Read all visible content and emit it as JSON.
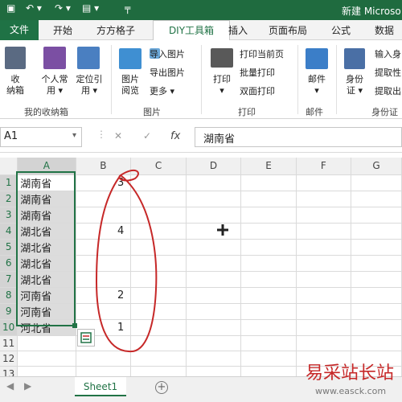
{
  "window": {
    "title": "新建 Microso"
  },
  "tabs": [
    {
      "label": "文件"
    },
    {
      "label": "开始"
    },
    {
      "label": "方方格子"
    },
    {
      "label": "DIY工具箱"
    },
    {
      "label": "插入"
    },
    {
      "label": "页面布局"
    },
    {
      "label": "公式"
    },
    {
      "label": "数据"
    }
  ],
  "ribbon": {
    "collect": {
      "line1": "收",
      "line2": "纳箱"
    },
    "personal": {
      "line1": "个人常",
      "line2": "用 ▾"
    },
    "locate": {
      "line1": "定位引",
      "line2": "用 ▾"
    },
    "picview": {
      "line1": "图片",
      "line2": "阅览"
    },
    "import_pic": "导入图片",
    "export_pic": "导出图片",
    "more": "更多 ▾",
    "print": {
      "label": "打印",
      "arrow": "▾"
    },
    "print_page": "打印当前页",
    "batch_print": "批量打印",
    "duplex_print": "双面打印",
    "mail": {
      "label": "邮件",
      "arrow": "▾"
    },
    "idcard": {
      "line1": "身份",
      "line2": "证 ▾"
    },
    "input_id": "输入身",
    "extract1": "提取性",
    "extract2": "提取出",
    "groups": {
      "my_box": "我的收纳箱",
      "picture": "图片",
      "print": "打印",
      "mail": "邮件",
      "idcard": "身份证"
    }
  },
  "formula_bar": {
    "name_box": "A1",
    "fx": "fx",
    "value": "湖南省"
  },
  "grid": {
    "columns": [
      "A",
      "B",
      "C",
      "D",
      "E",
      "F",
      "G"
    ],
    "rows": [
      {
        "n": "1",
        "a": "湖南省",
        "b": "3"
      },
      {
        "n": "2",
        "a": "湖南省",
        "b": ""
      },
      {
        "n": "3",
        "a": "湖南省",
        "b": ""
      },
      {
        "n": "4",
        "a": "湖北省",
        "b": "4"
      },
      {
        "n": "5",
        "a": "湖北省",
        "b": ""
      },
      {
        "n": "6",
        "a": "湖北省",
        "b": ""
      },
      {
        "n": "7",
        "a": "湖北省",
        "b": ""
      },
      {
        "n": "8",
        "a": "河南省",
        "b": "2"
      },
      {
        "n": "9",
        "a": "河南省",
        "b": ""
      },
      {
        "n": "10",
        "a": "河北省",
        "b": "1"
      },
      {
        "n": "11",
        "a": "",
        "b": ""
      },
      {
        "n": "12",
        "a": "",
        "b": ""
      },
      {
        "n": "13",
        "a": "",
        "b": ""
      },
      {
        "n": "14",
        "a": "",
        "b": ""
      }
    ]
  },
  "sheet": {
    "tab": "Sheet1",
    "add": "+"
  },
  "watermark": {
    "text": "易采站长站",
    "sub": "www.easck.com"
  },
  "colors": {
    "accent": "#217346",
    "annotation": "#c62828"
  }
}
